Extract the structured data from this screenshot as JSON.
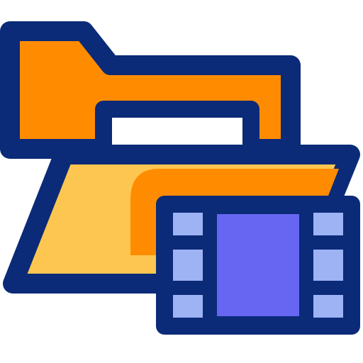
{
  "icon": {
    "name": "video-folder-icon",
    "colors": {
      "outline": "#0B2A78",
      "folder_orange": "#FF8C00",
      "folder_front": "#FCC650",
      "paper": "#FFFFFF",
      "film_frame": "#9DB3F3",
      "film_screen": "#6666F2"
    }
  }
}
